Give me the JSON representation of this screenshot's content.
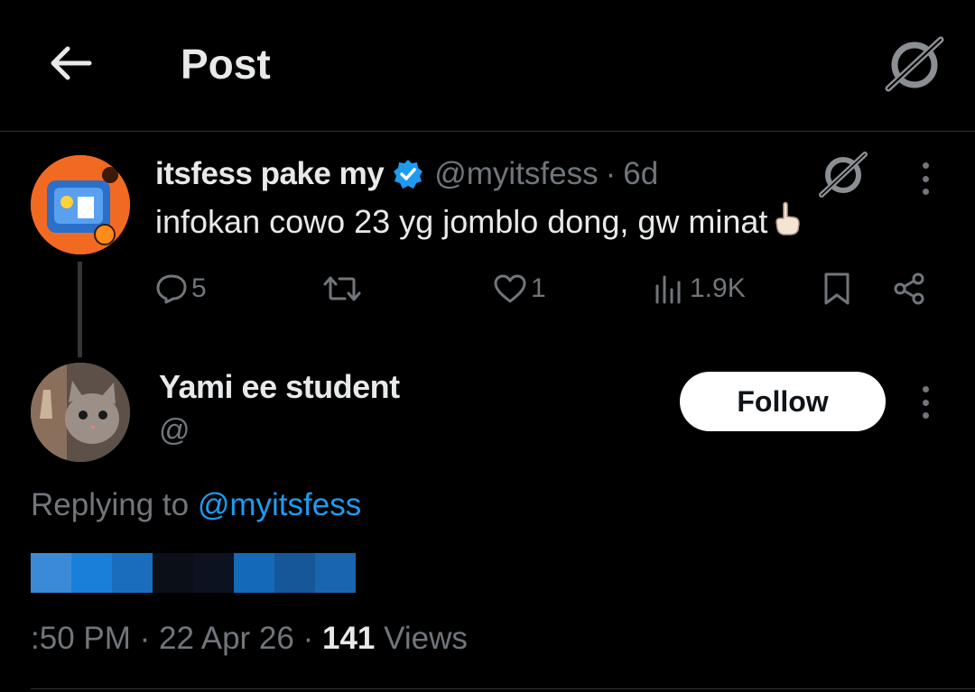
{
  "header": {
    "title": "Post",
    "back_icon": "arrow-left-icon",
    "grok_icon": "grok-icon"
  },
  "tweet": {
    "display_name": "itsfess pake my",
    "verified": true,
    "handle": "@myitsfess",
    "separator": "·",
    "age": "6d",
    "text": "infokan cowo 23 yg jomblo dong, gw minat",
    "emoji": "☝🏻",
    "actions": {
      "replies": "5",
      "reposts": "",
      "likes": "1",
      "views": "1.9K"
    },
    "avatar_colors": {
      "bg": "#f26a21",
      "accent": "#2a6fc9"
    }
  },
  "reply": {
    "display_name": "Yami ee student",
    "handle_partial": "@",
    "follow_label": "Follow",
    "replying_prefix": "Replying to",
    "replying_to": "@myitsfess",
    "time": ":50 PM",
    "date": "22 Apr 26",
    "views_count": "141",
    "views_label": "Views"
  },
  "colors": {
    "background": "#000000",
    "text": "#e7e9ea",
    "muted": "#71767b",
    "accent": "#1d9bf0",
    "divider": "#2f3336"
  }
}
